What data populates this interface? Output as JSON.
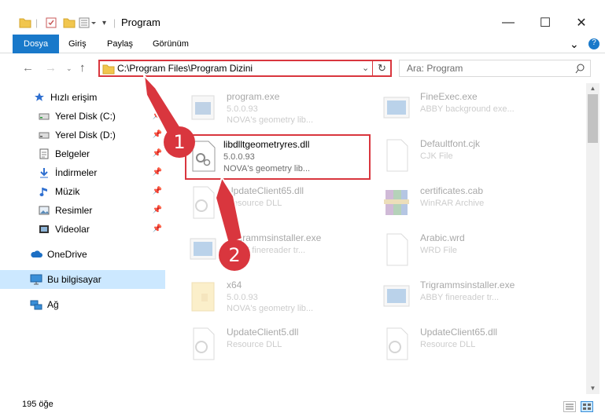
{
  "window": {
    "title": "Program",
    "minimize_glyph": "—",
    "maximize_glyph": "☐",
    "close_glyph": "✕"
  },
  "ribbon": {
    "tabs": [
      "Dosya",
      "Giriş",
      "Paylaş",
      "Görünüm"
    ],
    "active_tab_color": "#1979ca",
    "help_glyph": "?"
  },
  "nav": {
    "address_path": "C:\\Program Files\\Program Dizini",
    "search_placeholder": "Ara: Program",
    "highlight_color": "#d9363e"
  },
  "sidebar": {
    "items": [
      {
        "label": "Hızlı erişim",
        "icon": "star-icon",
        "pinned": false
      },
      {
        "label": "Yerel Disk (C:)",
        "icon": "drive-icon",
        "pinned": true
      },
      {
        "label": "Yerel Disk (D:)",
        "icon": "drive-icon",
        "pinned": true
      },
      {
        "label": "Belgeler",
        "icon": "documents-icon",
        "pinned": true
      },
      {
        "label": "İndirmeler",
        "icon": "download-icon",
        "pinned": true
      },
      {
        "label": "Müzik",
        "icon": "music-icon",
        "pinned": true
      },
      {
        "label": "Resimler",
        "icon": "pictures-icon",
        "pinned": true
      },
      {
        "label": "Videolar",
        "icon": "videos-icon",
        "pinned": true
      },
      {
        "label": "OneDrive",
        "icon": "cloud-icon",
        "pinned": false
      },
      {
        "label": "Bu bilgisayar",
        "icon": "computer-icon",
        "pinned": false,
        "selected": true
      },
      {
        "label": "Ağ",
        "icon": "network-icon",
        "pinned": false
      }
    ]
  },
  "files": {
    "left": [
      {
        "name": "program.exe",
        "line1": "5.0.0.93",
        "line2": "NOVA's geometry lib..."
      },
      {
        "name": "libdlltgeometryres.dll",
        "line1": "5.0.0.93",
        "line2": "NOVA's geometry lib...",
        "highlighted": true
      },
      {
        "name": "UpdateClient65.dll",
        "line1": "Resource DLL",
        "line2": ""
      },
      {
        "name": "Trigrammsinstaller.exe",
        "line1": "ABBY finereader tr...",
        "line2": ""
      },
      {
        "name": "x64",
        "line1": "5.0.0.93",
        "line2": "NOVA's geometry lib..."
      },
      {
        "name": "UpdateClient5.dll",
        "line1": "Resource DLL",
        "line2": ""
      }
    ],
    "right": [
      {
        "name": "FineExec.exe",
        "line1": "ABBY background exe...",
        "line2": ""
      },
      {
        "name": "Defaultfont.cjk",
        "line1": "CJK File",
        "line2": ""
      },
      {
        "name": "certificates.cab",
        "line1": "WinRAR Archive",
        "line2": ""
      },
      {
        "name": "Arabic.wrd",
        "line1": "WRD File",
        "line2": ""
      },
      {
        "name": "Trigrammsinstaller.exe",
        "line1": "ABBY finereader tr...",
        "line2": ""
      },
      {
        "name": "UpdateClient65.dll",
        "line1": "Resource DLL",
        "line2": ""
      }
    ]
  },
  "callouts": [
    "1",
    "2"
  ],
  "status": {
    "item_count": "195 öğe"
  }
}
